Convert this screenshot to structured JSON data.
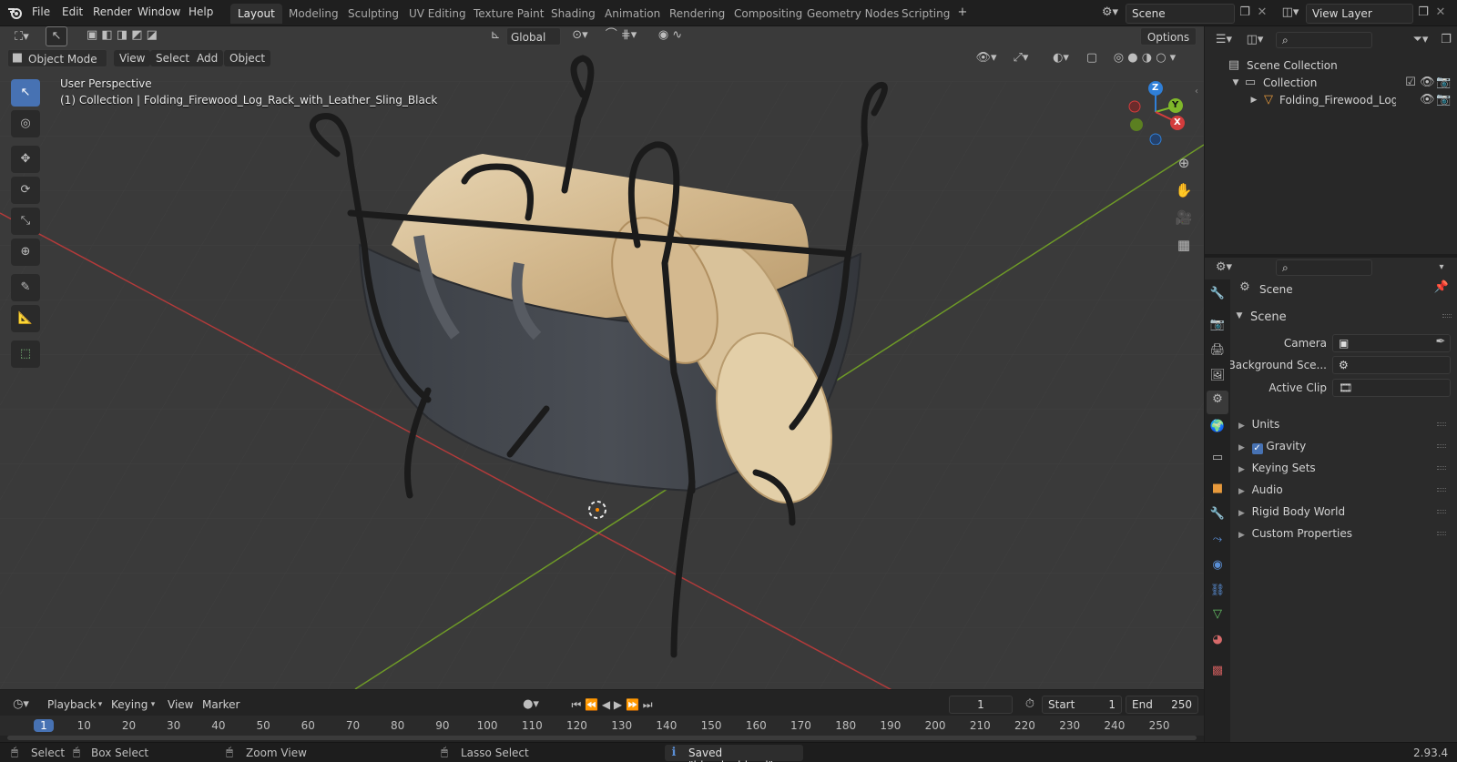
{
  "menu": {
    "file": "File",
    "edit": "Edit",
    "render": "Render",
    "window": "Window",
    "help": "Help"
  },
  "workspaces": [
    "Layout",
    "Modeling",
    "Sculpting",
    "UV Editing",
    "Texture Paint",
    "Shading",
    "Animation",
    "Rendering",
    "Compositing",
    "Geometry Nodes",
    "Scripting"
  ],
  "topright": {
    "scene": "Scene",
    "view_layer": "View Layer"
  },
  "viewport": {
    "transform_orientation": "Global",
    "options": "Options",
    "mode": "Object Mode",
    "menus": {
      "view": "View",
      "select": "Select",
      "add": "Add",
      "object": "Object"
    },
    "perspective": "User Perspective",
    "collection_info": "(1) Collection | Folding_Firewood_Log_Rack_with_Leather_Sling_Black",
    "gizmo": {
      "x": "X",
      "y": "Y",
      "z": "Z"
    }
  },
  "outliner": {
    "scene_collection": "Scene Collection",
    "collection": "Collection",
    "object": "Folding_Firewood_Log_Rä"
  },
  "properties": {
    "context": "Scene",
    "panel": "Scene",
    "camera_label": "Camera",
    "bg_label": "Background Sce...",
    "clip_label": "Active Clip",
    "sections": [
      "Units",
      "Gravity",
      "Keying Sets",
      "Audio",
      "Rigid Body World",
      "Custom Properties"
    ]
  },
  "timeline": {
    "playback": "Playback",
    "keying": "Keying",
    "view": "View",
    "marker": "Marker",
    "current": "1",
    "start_label": "Start",
    "start": "1",
    "end_label": "End",
    "end": "250",
    "ticks": [
      "1",
      "10",
      "20",
      "30",
      "40",
      "50",
      "60",
      "70",
      "80",
      "90",
      "100",
      "110",
      "120",
      "130",
      "140",
      "150",
      "160",
      "170",
      "180",
      "190",
      "200",
      "210",
      "220",
      "230",
      "240",
      "250"
    ]
  },
  "status": {
    "select": "Select",
    "box_select": "Box Select",
    "zoom_view": "Zoom View",
    "lasso_select": "Lasso Select",
    "saved": "Saved \"blender.blend\"",
    "version": "2.93.4"
  },
  "colors": {
    "accent": "#4772b3",
    "x_axis": "#d33c3c",
    "y_axis": "#7fb72a",
    "z_axis": "#2f7fd8"
  }
}
